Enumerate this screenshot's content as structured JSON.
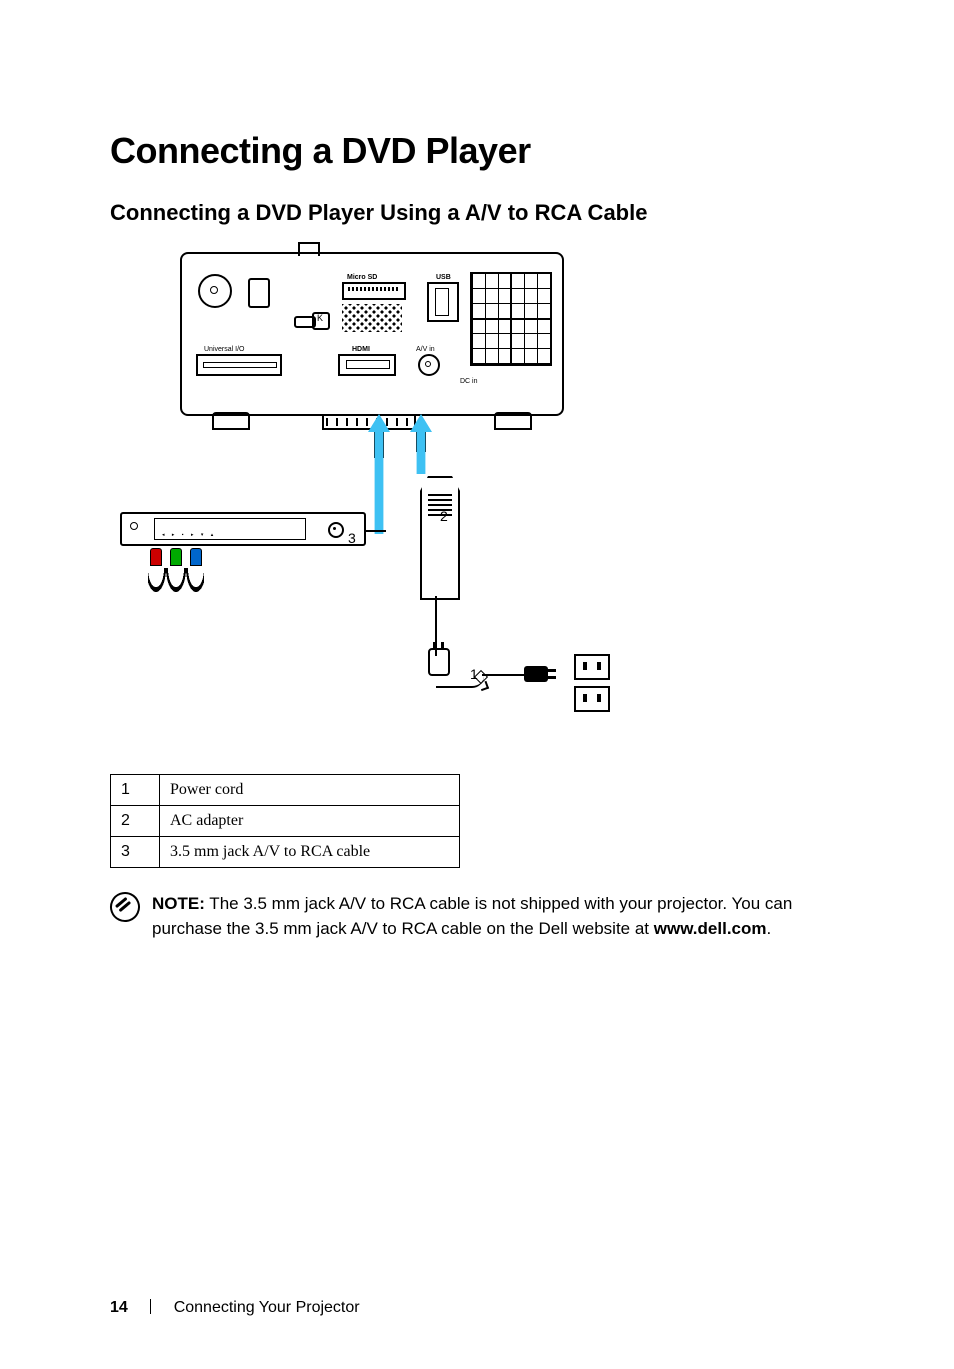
{
  "heading": "Connecting a DVD Player",
  "subheading": "Connecting a DVD Player Using a A/V to RCA Cable",
  "diagram_labels": {
    "micro_sd": "Micro SD",
    "usb": "USB",
    "universal_io": "Universal I/O",
    "hdmi": "HDMI",
    "av_in": "A/V in",
    "dc_in": "DC in"
  },
  "callouts": {
    "one": "1",
    "two": "2",
    "three": "3"
  },
  "legend": [
    {
      "num": "1",
      "label": "Power cord"
    },
    {
      "num": "2",
      "label": "AC adapter"
    },
    {
      "num": "3",
      "label": "3.5 mm jack A/V to RCA cable"
    }
  ],
  "note": {
    "lead": "NOTE:",
    "body_1": " The 3.5 mm jack A/V to RCA cable is not shipped with your projector. You can purchase the 3.5 mm jack A/V to RCA cable on the Dell website at ",
    "url": "www.dell.com",
    "body_2": "."
  },
  "footer": {
    "page_number": "14",
    "section": "Connecting Your Projector"
  }
}
